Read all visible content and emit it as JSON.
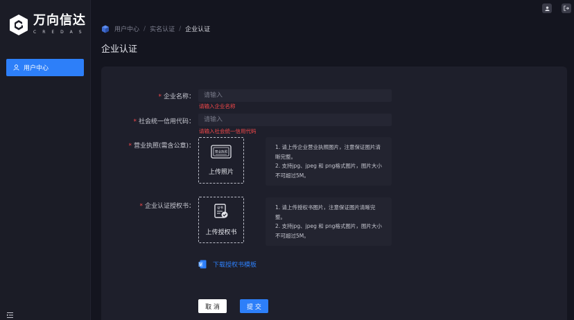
{
  "brand": {
    "name_cn": "万向信达",
    "name_en": "CREDAS"
  },
  "sidebar": {
    "items": [
      {
        "label": "用户中心",
        "icon": "user-icon"
      }
    ]
  },
  "breadcrumb": {
    "items": [
      "用户中心",
      "实名认证",
      "企业认证"
    ],
    "separator": "/"
  },
  "page_title": "企业认证",
  "form": {
    "company_name": {
      "label": "企业名称：",
      "placeholder": "请输入",
      "error": "请输入企业名称"
    },
    "credit_code": {
      "label": "社会统一信用代码：",
      "placeholder": "请输入",
      "error": "请输入社会统一信用代码"
    },
    "license": {
      "label": "营业执照(需含公章)：",
      "upload_label": "上传照片",
      "icon_text": "营业执照",
      "tips": [
        "1. 请上传企业营业执照图片，注意保证图片清晰完整。",
        "2. 支持jpg、jpeg 和 png格式图片，图片大小不可超过5M。"
      ]
    },
    "authorization": {
      "label": "企业认证授权书：",
      "upload_label": "上传授权书",
      "icon_text": "证书",
      "tips": [
        "1. 请上传授权书图片，注意保证图片清晰完整。",
        "2. 支持jpg、jpeg 和 png格式图片，图片大小不可超过5M。"
      ]
    },
    "download_template": "下载授权书模板",
    "cancel_label": "取 消",
    "submit_label": "提 交"
  },
  "colors": {
    "accent": "#2d7ff9",
    "error": "#f5484a",
    "background": "#14151f",
    "card": "#1e1f2b"
  }
}
